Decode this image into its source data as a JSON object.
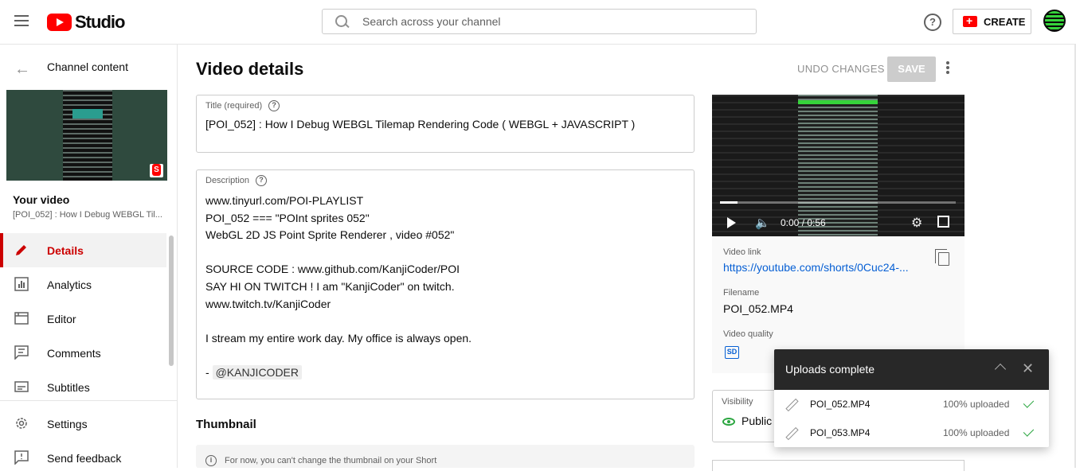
{
  "header": {
    "logo_text": "Studio",
    "search_placeholder": "Search across your channel",
    "create_label": "CREATE"
  },
  "sidebar": {
    "back_label": "Channel content",
    "your_video_label": "Your video",
    "video_title": "[POI_052] : How I Debug WEBGL Til...",
    "items": [
      {
        "label": "Details",
        "icon": "pencil-icon",
        "active": true
      },
      {
        "label": "Analytics",
        "icon": "analytics-icon"
      },
      {
        "label": "Editor",
        "icon": "editor-icon"
      },
      {
        "label": "Comments",
        "icon": "comments-icon"
      },
      {
        "label": "Subtitles",
        "icon": "subtitles-icon"
      }
    ],
    "footer_items": [
      {
        "label": "Settings",
        "icon": "gear-icon"
      },
      {
        "label": "Send feedback",
        "icon": "feedback-icon"
      }
    ]
  },
  "main": {
    "page_title": "Video details",
    "undo_label": "UNDO CHANGES",
    "save_label": "SAVE",
    "title_field": {
      "label": "Title (required)",
      "value": "[POI_052] : How I Debug WEBGL Tilemap Rendering Code ( WEBGL + JAVASCRIPT )"
    },
    "description_field": {
      "label": "Description",
      "lines": [
        "www.tinyurl.com/POI-PLAYLIST",
        "POI_052 === \"POInt sprites 052\"",
        "WebGL 2D JS Point Sprite Renderer , video #052\"",
        "",
        "SOURCE CODE : www.github.com/KanjiCoder/POI",
        "SAY HI ON TWITCH ! I am \"KanjiCoder\" on twitch.",
        "www.twitch.tv/KanjiCoder",
        "",
        "I stream my entire work day. My office is always open.",
        ""
      ],
      "signature_prefix": "- ",
      "signature_handle": "@KANJICODER"
    },
    "thumbnail_heading": "Thumbnail",
    "thumbnail_note": "For now, you can't change the thumbnail on your Short"
  },
  "preview": {
    "time": "0:00 / 0:56",
    "progress": 0.07,
    "video_link_label": "Video link",
    "video_link": "https://youtube.com/shorts/0Cuc24-...",
    "filename_label": "Filename",
    "filename": "POI_052.MP4",
    "quality_label": "Video quality",
    "quality_badge": "SD",
    "visibility_label": "Visibility",
    "visibility_value": "Public"
  },
  "uploads_toast": {
    "title": "Uploads complete",
    "rows": [
      {
        "filename": "POI_052.MP4",
        "status": "100% uploaded"
      },
      {
        "filename": "POI_053.MP4",
        "status": "100% uploaded"
      }
    ]
  },
  "colors": {
    "accent_red": "#cc0000",
    "link_blue": "#065fd4",
    "success_green": "#2ba640"
  }
}
